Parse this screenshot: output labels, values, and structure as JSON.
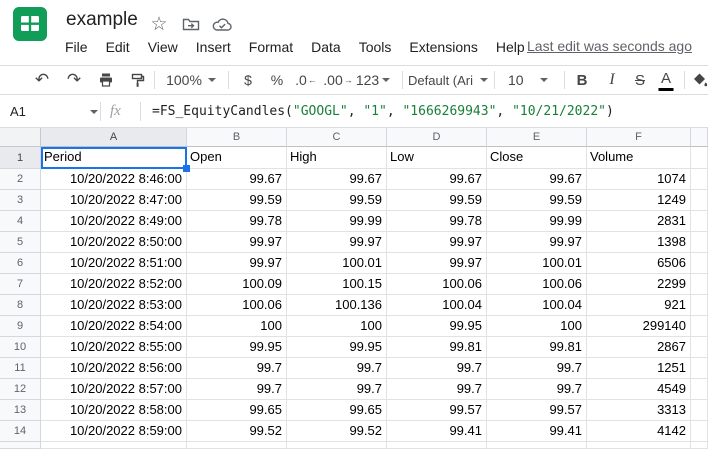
{
  "header": {
    "title": "example",
    "menu": [
      "File",
      "Edit",
      "View",
      "Insert",
      "Format",
      "Data",
      "Tools",
      "Extensions",
      "Help"
    ],
    "last_edit": "Last edit was seconds ago",
    "icons": {
      "star": "☆",
      "move_to_folder": "folder-with-arrow",
      "sync": "cloud-with-check"
    }
  },
  "toolbar": {
    "undo_glyph": "↶",
    "redo_glyph": "↷",
    "zoom": "100%",
    "currency": "$",
    "percent": "%",
    "decrease_decimal": ".0",
    "decrease_decimal_arrow": "←",
    "increase_decimal": ".00",
    "increase_decimal_arrow": "→",
    "more_formats": "123",
    "font": "Default (Ari…",
    "font_size": "10",
    "bold": "B",
    "italic": "I",
    "strikethrough": "S",
    "text_color": "A"
  },
  "formula_bar": {
    "name_box": "A1",
    "fx_label": "fx",
    "segments": [
      {
        "text": "=FS_EquityCandles(",
        "kind": "plain"
      },
      {
        "text": "\"GOOGL\"",
        "kind": "string"
      },
      {
        "text": ", ",
        "kind": "plain"
      },
      {
        "text": "\"1\"",
        "kind": "string"
      },
      {
        "text": ", ",
        "kind": "plain"
      },
      {
        "text": "\"1666269943\"",
        "kind": "string"
      },
      {
        "text": ", ",
        "kind": "plain"
      },
      {
        "text": "\"10/21/2022\"",
        "kind": "string"
      },
      {
        "text": ")",
        "kind": "plain"
      }
    ]
  },
  "sheet": {
    "selected_cell": "A1",
    "columns": [
      "A",
      "B",
      "C",
      "D",
      "E",
      "F"
    ],
    "rows": [
      {
        "num": "1",
        "cells": [
          "Period",
          "Open",
          "High",
          "Low",
          "Close",
          "Volume"
        ]
      },
      {
        "num": "2",
        "cells": [
          "10/20/2022 8:46:00",
          "99.67",
          "99.67",
          "99.67",
          "99.67",
          "1074"
        ]
      },
      {
        "num": "3",
        "cells": [
          "10/20/2022 8:47:00",
          "99.59",
          "99.59",
          "99.59",
          "99.59",
          "1249"
        ]
      },
      {
        "num": "4",
        "cells": [
          "10/20/2022 8:49:00",
          "99.78",
          "99.99",
          "99.78",
          "99.99",
          "2831"
        ]
      },
      {
        "num": "5",
        "cells": [
          "10/20/2022 8:50:00",
          "99.97",
          "99.97",
          "99.97",
          "99.97",
          "1398"
        ]
      },
      {
        "num": "6",
        "cells": [
          "10/20/2022 8:51:00",
          "99.97",
          "100.01",
          "99.97",
          "100.01",
          "6506"
        ]
      },
      {
        "num": "7",
        "cells": [
          "10/20/2022 8:52:00",
          "100.09",
          "100.15",
          "100.06",
          "100.06",
          "2299"
        ]
      },
      {
        "num": "8",
        "cells": [
          "10/20/2022 8:53:00",
          "100.06",
          "100.136",
          "100.04",
          "100.04",
          "921"
        ]
      },
      {
        "num": "9",
        "cells": [
          "10/20/2022 8:54:00",
          "100",
          "100",
          "99.95",
          "100",
          "299140"
        ]
      },
      {
        "num": "10",
        "cells": [
          "10/20/2022 8:55:00",
          "99.95",
          "99.95",
          "99.81",
          "99.81",
          "2867"
        ]
      },
      {
        "num": "11",
        "cells": [
          "10/20/2022 8:56:00",
          "99.7",
          "99.7",
          "99.7",
          "99.7",
          "1251"
        ]
      },
      {
        "num": "12",
        "cells": [
          "10/20/2022 8:57:00",
          "99.7",
          "99.7",
          "99.7",
          "99.7",
          "4549"
        ]
      },
      {
        "num": "13",
        "cells": [
          "10/20/2022 8:58:00",
          "99.65",
          "99.65",
          "99.57",
          "99.57",
          "3313"
        ]
      },
      {
        "num": "14",
        "cells": [
          "10/20/2022 8:59:00",
          "99.52",
          "99.52",
          "99.41",
          "99.41",
          "4142"
        ]
      }
    ]
  },
  "colors": {
    "accent_blue": "#1a73e8",
    "logo_green": "#0f9d58",
    "formula_string_green": "#188038",
    "header_highlight": "#e8eaed"
  }
}
